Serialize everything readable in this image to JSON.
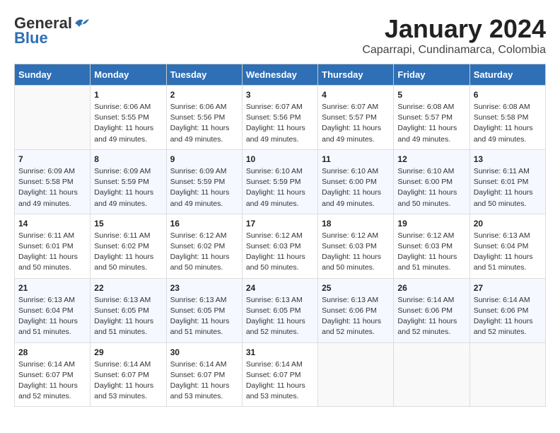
{
  "logo": {
    "general": "General",
    "blue": "Blue"
  },
  "title": "January 2024",
  "location": "Caparrapi, Cundinamarca, Colombia",
  "days_header": [
    "Sunday",
    "Monday",
    "Tuesday",
    "Wednesday",
    "Thursday",
    "Friday",
    "Saturday"
  ],
  "weeks": [
    [
      {
        "day": "",
        "info": ""
      },
      {
        "day": "1",
        "info": "Sunrise: 6:06 AM\nSunset: 5:55 PM\nDaylight: 11 hours\nand 49 minutes."
      },
      {
        "day": "2",
        "info": "Sunrise: 6:06 AM\nSunset: 5:56 PM\nDaylight: 11 hours\nand 49 minutes."
      },
      {
        "day": "3",
        "info": "Sunrise: 6:07 AM\nSunset: 5:56 PM\nDaylight: 11 hours\nand 49 minutes."
      },
      {
        "day": "4",
        "info": "Sunrise: 6:07 AM\nSunset: 5:57 PM\nDaylight: 11 hours\nand 49 minutes."
      },
      {
        "day": "5",
        "info": "Sunrise: 6:08 AM\nSunset: 5:57 PM\nDaylight: 11 hours\nand 49 minutes."
      },
      {
        "day": "6",
        "info": "Sunrise: 6:08 AM\nSunset: 5:58 PM\nDaylight: 11 hours\nand 49 minutes."
      }
    ],
    [
      {
        "day": "7",
        "info": "Sunrise: 6:09 AM\nSunset: 5:58 PM\nDaylight: 11 hours\nand 49 minutes."
      },
      {
        "day": "8",
        "info": "Sunrise: 6:09 AM\nSunset: 5:59 PM\nDaylight: 11 hours\nand 49 minutes."
      },
      {
        "day": "9",
        "info": "Sunrise: 6:09 AM\nSunset: 5:59 PM\nDaylight: 11 hours\nand 49 minutes."
      },
      {
        "day": "10",
        "info": "Sunrise: 6:10 AM\nSunset: 5:59 PM\nDaylight: 11 hours\nand 49 minutes."
      },
      {
        "day": "11",
        "info": "Sunrise: 6:10 AM\nSunset: 6:00 PM\nDaylight: 11 hours\nand 49 minutes."
      },
      {
        "day": "12",
        "info": "Sunrise: 6:10 AM\nSunset: 6:00 PM\nDaylight: 11 hours\nand 50 minutes."
      },
      {
        "day": "13",
        "info": "Sunrise: 6:11 AM\nSunset: 6:01 PM\nDaylight: 11 hours\nand 50 minutes."
      }
    ],
    [
      {
        "day": "14",
        "info": "Sunrise: 6:11 AM\nSunset: 6:01 PM\nDaylight: 11 hours\nand 50 minutes."
      },
      {
        "day": "15",
        "info": "Sunrise: 6:11 AM\nSunset: 6:02 PM\nDaylight: 11 hours\nand 50 minutes."
      },
      {
        "day": "16",
        "info": "Sunrise: 6:12 AM\nSunset: 6:02 PM\nDaylight: 11 hours\nand 50 minutes."
      },
      {
        "day": "17",
        "info": "Sunrise: 6:12 AM\nSunset: 6:03 PM\nDaylight: 11 hours\nand 50 minutes."
      },
      {
        "day": "18",
        "info": "Sunrise: 6:12 AM\nSunset: 6:03 PM\nDaylight: 11 hours\nand 50 minutes."
      },
      {
        "day": "19",
        "info": "Sunrise: 6:12 AM\nSunset: 6:03 PM\nDaylight: 11 hours\nand 51 minutes."
      },
      {
        "day": "20",
        "info": "Sunrise: 6:13 AM\nSunset: 6:04 PM\nDaylight: 11 hours\nand 51 minutes."
      }
    ],
    [
      {
        "day": "21",
        "info": "Sunrise: 6:13 AM\nSunset: 6:04 PM\nDaylight: 11 hours\nand 51 minutes."
      },
      {
        "day": "22",
        "info": "Sunrise: 6:13 AM\nSunset: 6:05 PM\nDaylight: 11 hours\nand 51 minutes."
      },
      {
        "day": "23",
        "info": "Sunrise: 6:13 AM\nSunset: 6:05 PM\nDaylight: 11 hours\nand 51 minutes."
      },
      {
        "day": "24",
        "info": "Sunrise: 6:13 AM\nSunset: 6:05 PM\nDaylight: 11 hours\nand 52 minutes."
      },
      {
        "day": "25",
        "info": "Sunrise: 6:13 AM\nSunset: 6:06 PM\nDaylight: 11 hours\nand 52 minutes."
      },
      {
        "day": "26",
        "info": "Sunrise: 6:14 AM\nSunset: 6:06 PM\nDaylight: 11 hours\nand 52 minutes."
      },
      {
        "day": "27",
        "info": "Sunrise: 6:14 AM\nSunset: 6:06 PM\nDaylight: 11 hours\nand 52 minutes."
      }
    ],
    [
      {
        "day": "28",
        "info": "Sunrise: 6:14 AM\nSunset: 6:07 PM\nDaylight: 11 hours\nand 52 minutes."
      },
      {
        "day": "29",
        "info": "Sunrise: 6:14 AM\nSunset: 6:07 PM\nDaylight: 11 hours\nand 53 minutes."
      },
      {
        "day": "30",
        "info": "Sunrise: 6:14 AM\nSunset: 6:07 PM\nDaylight: 11 hours\nand 53 minutes."
      },
      {
        "day": "31",
        "info": "Sunrise: 6:14 AM\nSunset: 6:07 PM\nDaylight: 11 hours\nand 53 minutes."
      },
      {
        "day": "",
        "info": ""
      },
      {
        "day": "",
        "info": ""
      },
      {
        "day": "",
        "info": ""
      }
    ]
  ]
}
